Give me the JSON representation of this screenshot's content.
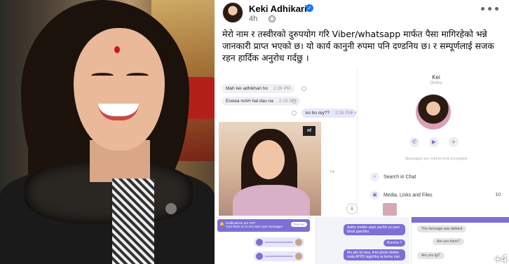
{
  "post": {
    "author": "Keki Adhikari",
    "time": "4h",
    "text": "मेरो नाम र तस्वीरको दुरुपयोग गरि Viber/whatsapp मार्फत पैसा मागिरहेको भन्ने जानकारी प्राप्त भएको छ। यो कार्य कानुनी रुपमा पनि दण्डनिय छ। र सम्पूर्णलाई सजक रहन हार्दिक अनुरोध गर्दछु ।",
    "more_label": "•••"
  },
  "chat1": {
    "messages": [
      {
        "text": "Mah kei adhikhari ho",
        "time": "2:26 PM"
      },
      {
        "text": "Esewa mAH hal dau na",
        "time": "2:26 PM"
      }
    ],
    "outgoing": {
      "text": "ko ho rey??",
      "time": "2:28 PM"
    },
    "photo_watermark": "nf"
  },
  "contact": {
    "name": "Kei",
    "status": "Online",
    "e2e": "Messages are end-to-end encrypted",
    "menu": [
      {
        "icon": "search-icon",
        "label": "Search in Chat",
        "count": ""
      },
      {
        "icon": "media-icon",
        "label": "Media, Links and Files",
        "count": "10"
      }
    ]
  },
  "chat3": {
    "notif_title": "Notifications are OFF",
    "notif_sub": "Turn them on to not miss new messages",
    "notif_button": "Turn on"
  },
  "chat4": {
    "messages": [
      "Aafno mobile aaye yachhi yo pani block garchhu",
      "Huncha ?",
      "Ma aile ko tara, time photo delete mala APPS lagichha ra hernu mai"
    ]
  },
  "chat5": {
    "messages": [
      "The message was deleted",
      "Are you there?",
      "Are you tgi?"
    ]
  },
  "colors": {
    "viber_purple": "#7c6fd6",
    "fb_blue": "#1877f2"
  }
}
